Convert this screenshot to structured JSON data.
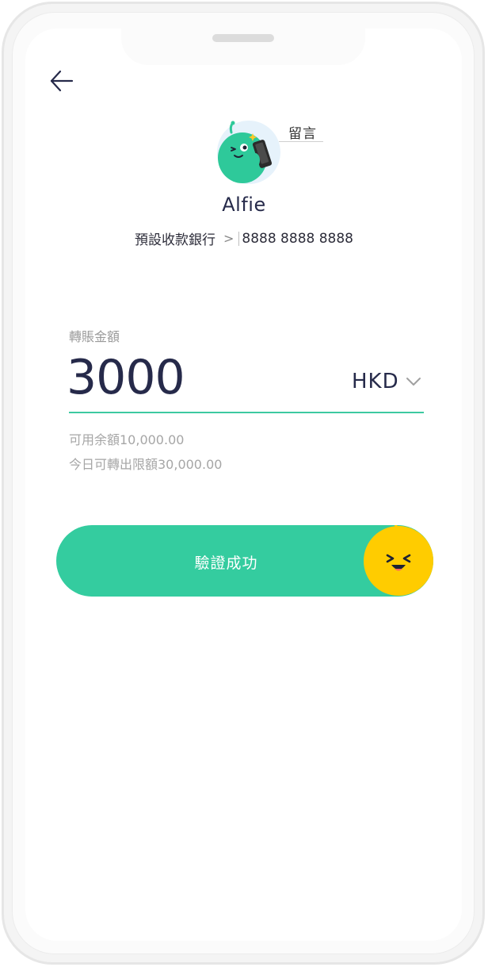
{
  "header": {
    "back_icon": "arrow-left-icon"
  },
  "recipient": {
    "avatar_icon": "green-mascot-avatar",
    "message_label": "留言",
    "name": "Alfie",
    "bank_label": "預設收款銀行",
    "bank_chevron": ">",
    "account_number": "8888 8888 8888"
  },
  "transfer": {
    "amount_label": "轉賬金額",
    "amount_value": "3000",
    "currency": "HKD",
    "available_balance": "可用余額10,000.00",
    "daily_limit": "今日可轉出限額30,000.00"
  },
  "slider": {
    "label": "驗證成功",
    "thumb_icon": "smiley-face-icon"
  },
  "colors": {
    "accent": "#34cc9f",
    "underline": "#3dc9a0",
    "thumb": "#ffcc00",
    "text_dark": "#262a4a",
    "text_muted": "#a6a6a6"
  }
}
